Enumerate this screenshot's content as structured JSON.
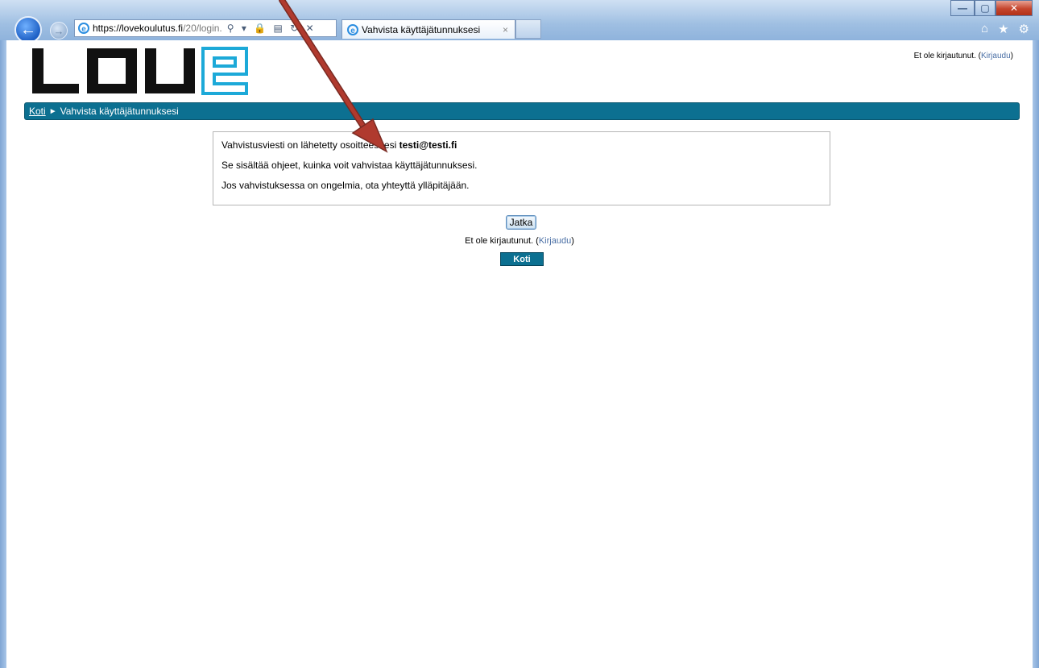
{
  "browser": {
    "url_host": "https://lovekoulutus.fi",
    "url_path": "/20/login.",
    "tab_title": "Vahvista käyttäjätunnuksesi",
    "tab_close": "×",
    "back_icon": "arrow-left-icon",
    "forward_icon": "arrow-right-icon",
    "address_icons": "⚲ ▾ 🔒 ▤ ↻ ✕",
    "toolbar": [
      "home-icon",
      "star-icon",
      "gear-icon"
    ],
    "window_controls": {
      "minimize": "—",
      "maximize": "▢",
      "close": "✕"
    }
  },
  "header": {
    "logo_text": "LOVE",
    "login_status_text": "Et ole kirjautunut. (",
    "login_link": "Kirjaudu",
    "login_status_end": ")"
  },
  "navbar": {
    "home": "Koti",
    "separator": "►",
    "current": "Vahvista käyttäjätunnuksesi"
  },
  "message": {
    "line1_prefix": "Vahvistusviesti on lähetetty osoitteeseesi ",
    "email": "testi@testi.fi",
    "line2": "Se sisältää ohjeet, kuinka voit vahvistaa käyttäjätunnuksesi.",
    "line3": "Jos vahvistuksessa on ongelmia, ota yhteyttä ylläpitäjään."
  },
  "actions": {
    "continue_label": "Jatka",
    "home_label": "Koti"
  },
  "footer": {
    "login_status_text": "Et ole kirjautunut. (",
    "login_link": "Kirjaudu",
    "login_status_end": ")"
  },
  "colors": {
    "brand_teal": "#0c7091",
    "logo_cyan": "#1ca9d8",
    "logo_black": "#111111",
    "annotation_arrow": "#b03a2e"
  }
}
